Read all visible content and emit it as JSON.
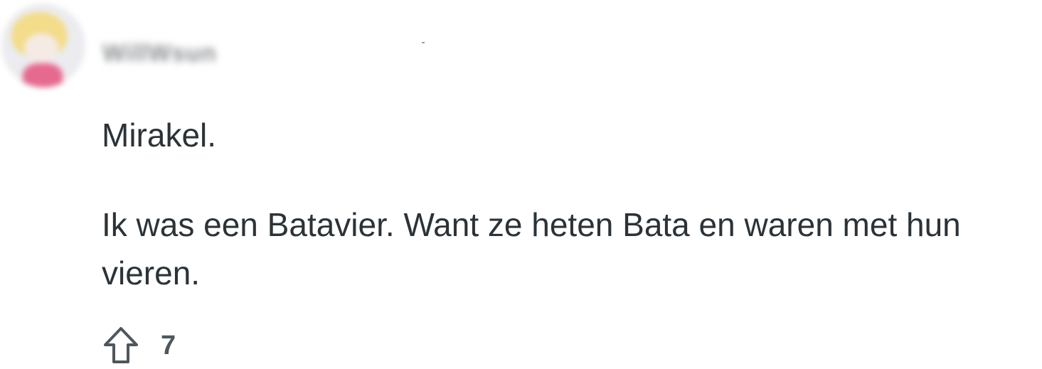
{
  "comment": {
    "author": "WillWsun",
    "body_paragraphs": [
      "Mirakel.",
      "Ik was een Batavier. Want ze heten Bata en waren met hun vieren."
    ],
    "upvote_icon": "arrow-up-outline-icon",
    "vote_count": "7"
  },
  "colors": {
    "text": "#2b3338",
    "meta": "#4f575c",
    "background": "#ffffff"
  }
}
